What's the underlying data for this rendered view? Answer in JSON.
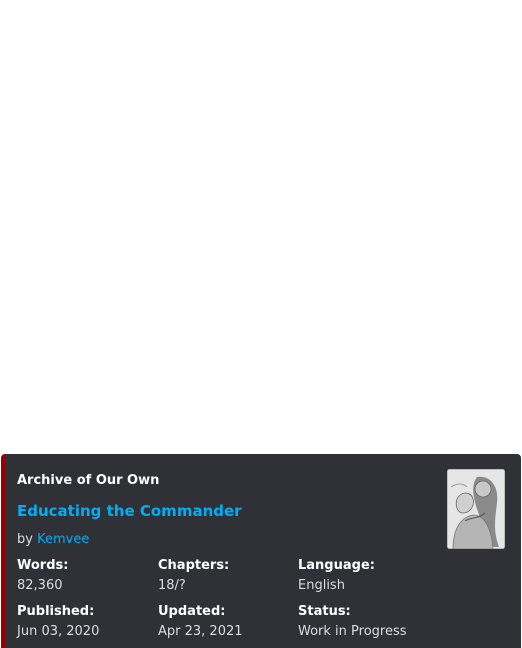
{
  "embed": {
    "provider": "Archive of Our Own",
    "title": "Educating the Commander",
    "author_prefix": "by",
    "author": "Kemvee",
    "accent_color": "#990000",
    "fields": [
      {
        "name": "Words:",
        "value": "82,360"
      },
      {
        "name": "Chapters:",
        "value": "18/?"
      },
      {
        "name": "Language:",
        "value": "English"
      },
      {
        "name": "Published:",
        "value": "Jun 03, 2020"
      },
      {
        "name": "Updated:",
        "value": "Apr 23, 2021"
      },
      {
        "name": "Status:",
        "value": "Work in Progress"
      }
    ]
  }
}
